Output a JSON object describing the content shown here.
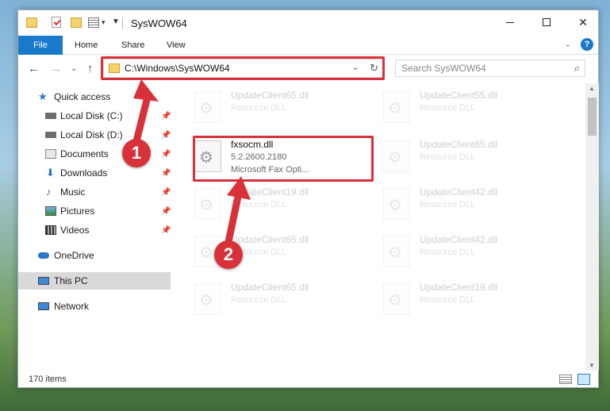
{
  "window": {
    "title": "SysWOW64",
    "qa_dropdown": "▾",
    "qa_pin": "▼"
  },
  "ribbon": {
    "file": "File",
    "home": "Home",
    "share": "Share",
    "view": "View",
    "help": "?"
  },
  "nav": {
    "address": "C:\\Windows\\SysWOW64",
    "search_placeholder": "Search SysWOW64"
  },
  "sidebar": {
    "items": [
      {
        "label": "Quick access",
        "icon": "star-icon",
        "pinned": false
      },
      {
        "label": "Local Disk (C:)",
        "icon": "disk-icon",
        "pinned": true
      },
      {
        "label": "Local Disk (D:)",
        "icon": "disk-icon",
        "pinned": true
      },
      {
        "label": "Documents",
        "icon": "documents-icon",
        "pinned": true
      },
      {
        "label": "Downloads",
        "icon": "downloads-icon",
        "pinned": true
      },
      {
        "label": "Music",
        "icon": "music-icon",
        "pinned": true
      },
      {
        "label": "Pictures",
        "icon": "pictures-icon",
        "pinned": true
      },
      {
        "label": "Videos",
        "icon": "videos-icon",
        "pinned": true
      },
      {
        "label": "OneDrive",
        "icon": "onedrive-icon",
        "pinned": false
      },
      {
        "label": "This PC",
        "icon": "this-pc-icon",
        "pinned": false,
        "selected": true
      },
      {
        "label": "Network",
        "icon": "network-icon",
        "pinned": false
      }
    ]
  },
  "files": {
    "focused": {
      "name": "fxsocm.dll",
      "version": "5.2.2600.2180",
      "description": "Microsoft  Fax Opti..."
    },
    "left_column": [
      {
        "name": "UpdateClient65.dll",
        "description": "Resource DLL"
      },
      {
        "name": "UpdateClient19.dll",
        "description": "Resource DLL"
      },
      {
        "name": "UpdateClient65.dll",
        "description": "Resource DLL"
      },
      {
        "name": "UpdateClient65.dll",
        "description": "Resource DLL"
      }
    ],
    "right_column": [
      {
        "name": "UpdateClient55.dll",
        "description": "Resource DLL"
      },
      {
        "name": "UpdateClient65.dll",
        "description": "Resource DLL"
      },
      {
        "name": "UpdateClient42.dll",
        "description": "Resource DLL"
      },
      {
        "name": "UpdateClient42.dll",
        "description": "Resource DLL"
      },
      {
        "name": "UpdateClient19.dll",
        "description": "Resource DLL"
      }
    ]
  },
  "status": {
    "count": "170 items"
  },
  "callouts": {
    "step1": "1",
    "step2": "2"
  },
  "colors": {
    "accent": "#1979ca",
    "callout": "#d8313a"
  }
}
